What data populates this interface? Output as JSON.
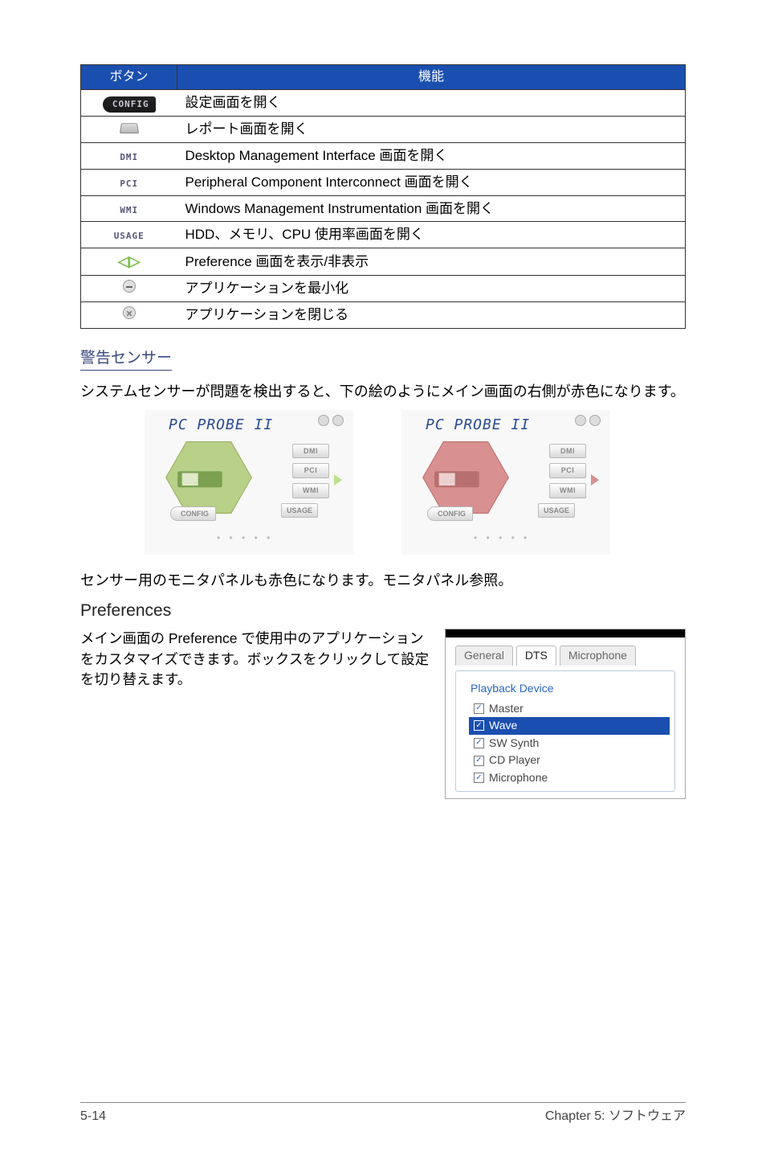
{
  "table": {
    "headers": {
      "button": "ボタン",
      "function": "機能"
    },
    "rows": [
      {
        "iconKey": "config",
        "iconText": "CONFIG",
        "desc": "設定画面を開く"
      },
      {
        "iconKey": "folder",
        "iconText": "",
        "desc": "レポート画面を開く"
      },
      {
        "iconKey": "dmi",
        "iconText": "DMI",
        "desc": "Desktop Management Interface 画面を開く"
      },
      {
        "iconKey": "pci",
        "iconText": "PCI",
        "desc": "Peripheral Component Interconnect 画面を開く"
      },
      {
        "iconKey": "wmi",
        "iconText": "WMI",
        "desc": "Windows Management Instrumentation 画面を開く"
      },
      {
        "iconKey": "usage",
        "iconText": "USAGE",
        "desc": "HDD、メモリ、CPU 使用率画面を開く"
      },
      {
        "iconKey": "arrows",
        "iconText": "◁▷",
        "desc": "Preference 画面を表示/非表示"
      },
      {
        "iconKey": "minimize",
        "iconText": "",
        "desc": "アプリケーションを最小化"
      },
      {
        "iconKey": "close",
        "iconText": "",
        "desc": "アプリケーションを閉じる"
      }
    ]
  },
  "alarm": {
    "heading": "警告センサー",
    "text": "システムセンサーが問題を検出すると、下の絵のようにメイン画面の右側が赤色になります。",
    "note": "センサー用のモニタパネルも赤色になります。モニタパネル参照。"
  },
  "probe": {
    "title": "PC PROBE II",
    "sideButtons": [
      "DMI",
      "PCI",
      "WMI"
    ],
    "configLabel": "CONFIG",
    "usageLabel": "USAGE"
  },
  "prefs": {
    "title": "Preferences",
    "text": "メイン画面の Preference で使用中のアプリケーションをカスタマイズできます。ボックスをクリックして設定を切り替えます。",
    "tabs": [
      "General",
      "DTS",
      "Microphone"
    ],
    "groupTitle": "Playback Device",
    "items": [
      {
        "label": "Master",
        "checked": true,
        "selected": false
      },
      {
        "label": "Wave",
        "checked": true,
        "selected": true
      },
      {
        "label": "SW Synth",
        "checked": true,
        "selected": false
      },
      {
        "label": "CD Player",
        "checked": true,
        "selected": false
      },
      {
        "label": "Microphone",
        "checked": true,
        "selected": false
      }
    ]
  },
  "footer": {
    "left": "5-14",
    "right": "Chapter 5: ソフトウェア"
  }
}
